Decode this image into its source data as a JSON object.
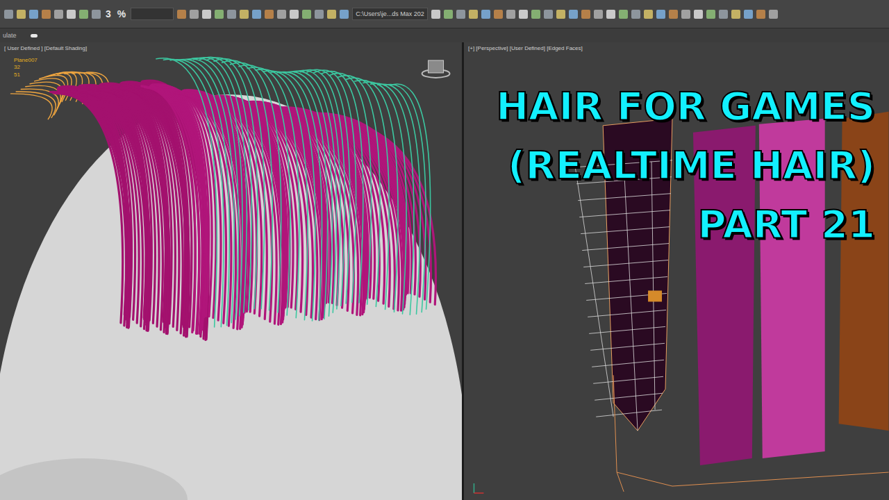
{
  "toolbar": {
    "items": [
      "3",
      "%"
    ],
    "path": "C:\\Users\\je...ds Max 202"
  },
  "subbar": {
    "label": "ulate"
  },
  "viewports": [
    {
      "label": "[ User Defined ] [Default Shading]",
      "stats": [
        "Plane007",
        "32",
        "51"
      ]
    },
    {
      "label": "[+] [Perspective] [User Defined] [Edged Faces]",
      "stats": []
    }
  ],
  "title": {
    "lines": [
      "HAIR FOR GAMES",
      "(REALTIME HAIR)",
      "PART 21"
    ]
  }
}
